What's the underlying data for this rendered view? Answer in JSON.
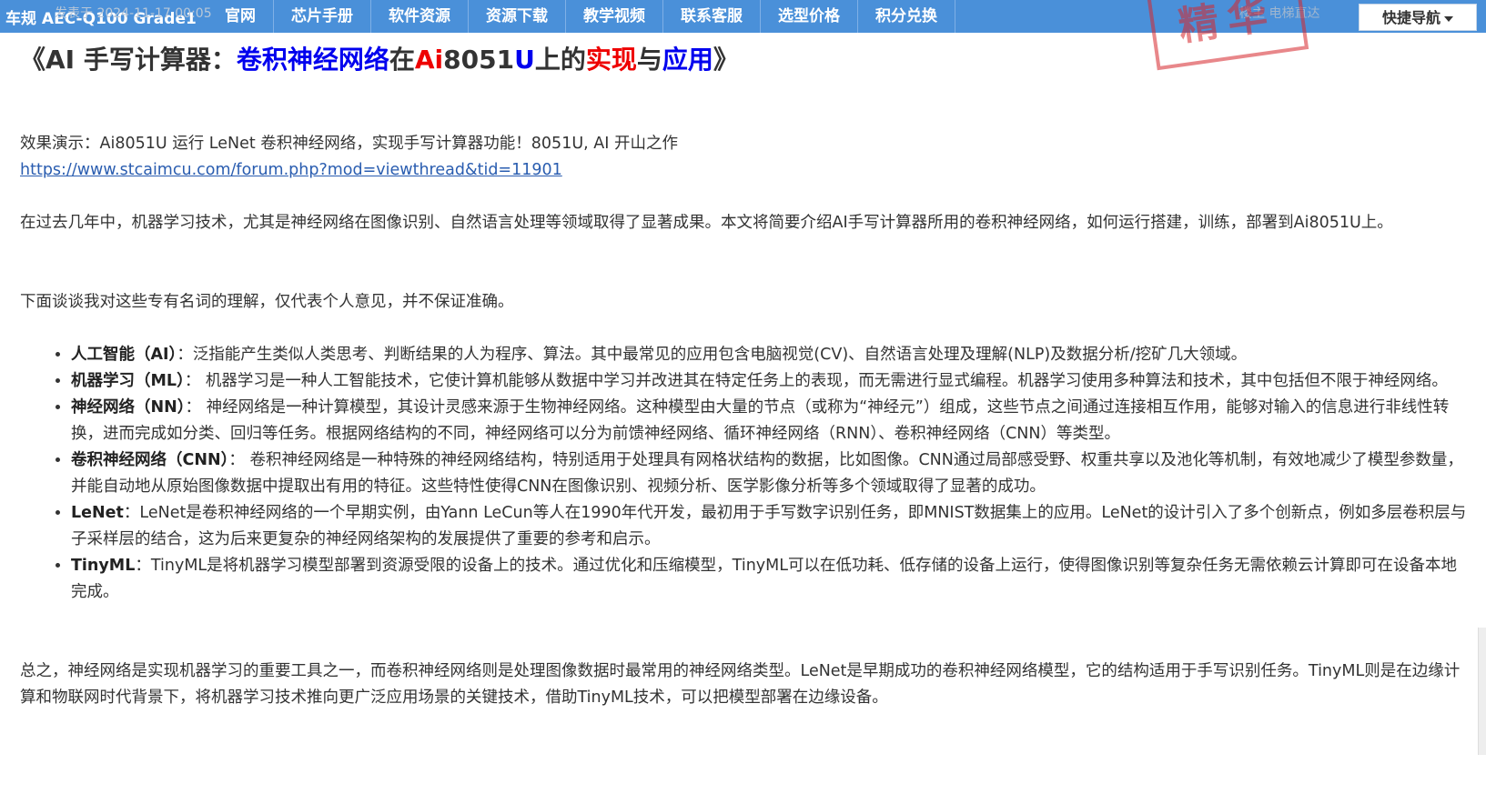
{
  "nav": {
    "brand": "车规 AEC-Q100 Grade1",
    "items": [
      "官网",
      "芯片手册",
      "软件资源",
      "资源下载",
      "教学视频",
      "联系客服",
      "选型价格",
      "积分兑换"
    ],
    "ghost_left": "发表于 2024-11-17 00:05",
    "ghost_right": "楼主  电梯直达",
    "stamp_text": "精华",
    "quick_nav": "快捷导航"
  },
  "post": {
    "title_parts": [
      {
        "text": "《AI 手写计算器：",
        "color": "default"
      },
      {
        "text": "卷积神经网络",
        "color": "blue"
      },
      {
        "text": "在",
        "color": "default"
      },
      {
        "text": "Ai",
        "color": "red"
      },
      {
        "text": "8051",
        "color": "default"
      },
      {
        "text": "U",
        "color": "blue"
      },
      {
        "text": "上的",
        "color": "default"
      },
      {
        "text": "实现",
        "color": "red"
      },
      {
        "text": "与",
        "color": "default"
      },
      {
        "text": "应用",
        "color": "blue"
      },
      {
        "text": "》",
        "color": "default"
      }
    ],
    "demo_line": "效果演示：Ai8051U 运行 LeNet 卷积神经网络，实现手写计算器功能！8051U, AI 开山之作",
    "demo_link": "https://www.stcaimcu.com/forum.php?mod=viewthread&tid=11901",
    "intro": "在过去几年中，机器学习技术，尤其是神经网络在图像识别、自然语言处理等领域取得了显著成果。本文将简要介绍AI手写计算器所用的卷积神经网络，如何运行搭建，训练，部署到Ai8051U上。",
    "terms_intro": "下面谈谈我对这些专有名词的理解，仅代表个人意见，并不保证准确。",
    "terms": [
      {
        "term": "人工智能（AI）",
        "sep": "：",
        "desc": "泛指能产生类似人类思考、判断结果的人为程序、算法。其中最常见的应用包含电脑视觉(CV)、自然语言处理及理解(NLP)及数据分析/挖矿几大领域。"
      },
      {
        "term": "机器学习（ML）",
        "sep": "： ",
        "desc": "机器学习是一种人工智能技术，它使计算机能够从数据中学习并改进其在特定任务上的表现，而无需进行显式编程。机器学习使用多种算法和技术，其中包括但不限于神经网络。"
      },
      {
        "term": "神经网络（NN）",
        "sep": "： ",
        "desc": "神经网络是一种计算模型，其设计灵感来源于生物神经网络。这种模型由大量的节点（或称为“神经元”）组成，这些节点之间通过连接相互作用，能够对输入的信息进行非线性转换，进而完成如分类、回归等任务。根据网络结构的不同，神经网络可以分为前馈神经网络、循环神经网络（RNN）、卷积神经网络（CNN）等类型。"
      },
      {
        "term": "卷积神经网络（CNN）",
        "sep": "： ",
        "desc": "卷积神经网络是一种特殊的神经网络结构，特别适用于处理具有网格状结构的数据，比如图像。CNN通过局部感受野、权重共享以及池化等机制，有效地减少了模型参数量，并能自动地从原始图像数据中提取出有用的特征。这些特性使得CNN在图像识别、视频分析、医学影像分析等多个领域取得了显著的成功。"
      },
      {
        "term": "LeNet",
        "sep": "：",
        "desc": "LeNet是卷积神经网络的一个早期实例，由Yann LeCun等人在1990年代开发，最初用于手写数字识别任务，即MNIST数据集上的应用。LeNet的设计引入了多个创新点，例如多层卷积层与子采样层的结合，这为后来更复杂的神经网络架构的发展提供了重要的参考和启示。"
      },
      {
        "term": "TinyML",
        "sep": "：",
        "desc": "TinyML是将机器学习模型部署到资源受限的设备上的技术。通过优化和压缩模型，TinyML可以在低功耗、低存储的设备上运行，使得图像识别等复杂任务无需依赖云计算即可在设备本地完成。"
      }
    ],
    "conclusion": "总之，神经网络是实现机器学习的重要工具之一，而卷积神经网络则是处理图像数据时最常用的神经网络类型。LeNet是早期成功的卷积神经网络模型，它的结构适用于手写识别任务。TinyML则是在边缘计算和物联网时代背景下，将机器学习技术推向更广泛应用场景的关键技术，借助TinyML技术，可以把模型部署在边缘设备。"
  },
  "colors": {
    "nav_bg": "#4a90d9",
    "title_blue": "#0000ee",
    "title_red": "#ee0000",
    "link": "#2a5db0"
  }
}
